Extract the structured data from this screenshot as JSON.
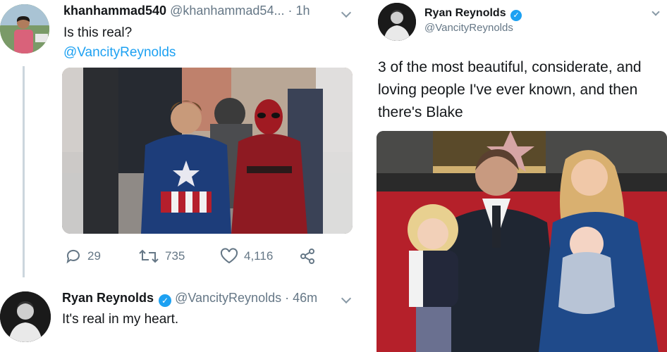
{
  "tweet1": {
    "username": "khanhammad540",
    "handle": "@khanhammad54...",
    "time": "· 1h",
    "text": "Is this real?",
    "mention": "@VancityReynolds",
    "stats": {
      "replies": "29",
      "retweets": "735",
      "likes": "4,116"
    }
  },
  "reply": {
    "name": "Ryan Reynolds",
    "handle": "@VancityReynolds",
    "time": "· 46m",
    "text": "It's real in my heart."
  },
  "tweet2": {
    "name": "Ryan Reynolds",
    "handle": "@VancityReynolds",
    "text_line1": "3 of the most beautiful, considerate, and",
    "text_line2": "loving people I've ever known, and then",
    "text_line3": "there's Blake"
  },
  "colors": {
    "link": "#1da1f2",
    "gray": "#657786",
    "verified": "#1da1f2",
    "carpet": "#b5202a"
  }
}
